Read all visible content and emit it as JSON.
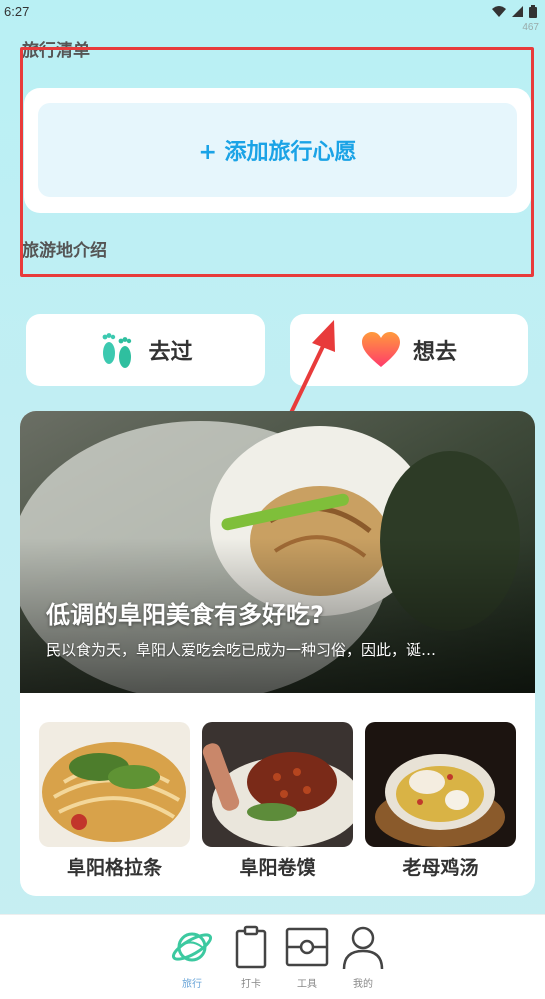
{
  "status": {
    "time": "6:27",
    "overlay": "467"
  },
  "sections": {
    "wishlist_title": "旅行清单",
    "intro_title": "旅游地介绍"
  },
  "add_wish": {
    "label": "+ 添加旅行心愿"
  },
  "quick": [
    {
      "label": "去过",
      "icon": "footprints-icon"
    },
    {
      "label": "想去",
      "icon": "heart-icon"
    }
  ],
  "feature": {
    "title": "低调的阜阳美食有多好吃?",
    "subtitle": "民以食为天，阜阳人爱吃会吃已成为一种习俗，因此，诞…"
  },
  "foods": [
    {
      "name": "阜阳格拉条"
    },
    {
      "name": "阜阳卷馍"
    },
    {
      "name": "老母鸡汤"
    }
  ],
  "nav": [
    {
      "label": "旅行",
      "icon": "planet-icon",
      "active": true
    },
    {
      "label": "打卡",
      "icon": "clipboard-icon",
      "active": false
    },
    {
      "label": "工具",
      "icon": "toolbox-icon",
      "active": false
    },
    {
      "label": "我的",
      "icon": "person-icon",
      "active": false
    }
  ],
  "colors": {
    "accent": "#1aa3e6",
    "annotation": "#e83b3b",
    "nav_active": "#3cc9a0"
  }
}
